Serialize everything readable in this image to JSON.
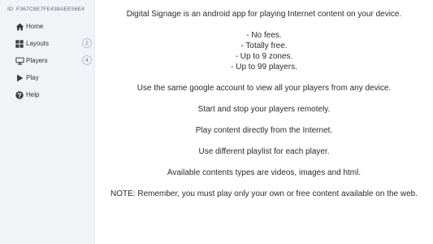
{
  "sidebar": {
    "device_id": "ID: F367C8E7FE438AEE56E4",
    "items": [
      {
        "label": "Home",
        "icon": "home-icon"
      },
      {
        "label": "Layouts",
        "icon": "grid-icon",
        "badge": "2"
      },
      {
        "label": "Players",
        "icon": "monitor-icon",
        "badge": "4"
      },
      {
        "label": "Play",
        "icon": "play-icon"
      },
      {
        "label": "Help",
        "icon": "help-icon"
      }
    ]
  },
  "main": {
    "intro": "Digital Signage is an android app for playing Internet content on your device.",
    "features": [
      "- No fees.",
      "- Totally free.",
      "- Up to 9 zones.",
      "- Up to 99 players."
    ],
    "paragraphs": [
      "Use the same google account to view all your players from any device.",
      "Start and stop your players remotely.",
      "Play content directly from the Internet.",
      "Use different playlist for each player.",
      "Available contents types are videos, images and html.",
      "NOTE: Remember, you must play only your own or free content available on the web."
    ]
  },
  "colors": {
    "sidebar_bg": "#f1f3f7",
    "icon": "#3a3d42",
    "text": "#2b2b2b"
  }
}
